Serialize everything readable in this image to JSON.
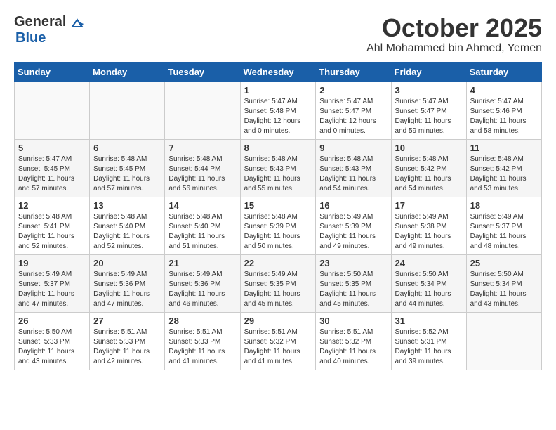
{
  "header": {
    "logo_general": "General",
    "logo_blue": "Blue",
    "month": "October 2025",
    "location": "Ahl Mohammed bin Ahmed, Yemen"
  },
  "calendar": {
    "days_of_week": [
      "Sunday",
      "Monday",
      "Tuesday",
      "Wednesday",
      "Thursday",
      "Friday",
      "Saturday"
    ],
    "rows": [
      [
        {
          "day": "",
          "info": ""
        },
        {
          "day": "",
          "info": ""
        },
        {
          "day": "",
          "info": ""
        },
        {
          "day": "1",
          "info": "Sunrise: 5:47 AM\nSunset: 5:48 PM\nDaylight: 12 hours\nand 0 minutes."
        },
        {
          "day": "2",
          "info": "Sunrise: 5:47 AM\nSunset: 5:47 PM\nDaylight: 12 hours\nand 0 minutes."
        },
        {
          "day": "3",
          "info": "Sunrise: 5:47 AM\nSunset: 5:47 PM\nDaylight: 11 hours\nand 59 minutes."
        },
        {
          "day": "4",
          "info": "Sunrise: 5:47 AM\nSunset: 5:46 PM\nDaylight: 11 hours\nand 58 minutes."
        }
      ],
      [
        {
          "day": "5",
          "info": "Sunrise: 5:47 AM\nSunset: 5:45 PM\nDaylight: 11 hours\nand 57 minutes."
        },
        {
          "day": "6",
          "info": "Sunrise: 5:48 AM\nSunset: 5:45 PM\nDaylight: 11 hours\nand 57 minutes."
        },
        {
          "day": "7",
          "info": "Sunrise: 5:48 AM\nSunset: 5:44 PM\nDaylight: 11 hours\nand 56 minutes."
        },
        {
          "day": "8",
          "info": "Sunrise: 5:48 AM\nSunset: 5:43 PM\nDaylight: 11 hours\nand 55 minutes."
        },
        {
          "day": "9",
          "info": "Sunrise: 5:48 AM\nSunset: 5:43 PM\nDaylight: 11 hours\nand 54 minutes."
        },
        {
          "day": "10",
          "info": "Sunrise: 5:48 AM\nSunset: 5:42 PM\nDaylight: 11 hours\nand 54 minutes."
        },
        {
          "day": "11",
          "info": "Sunrise: 5:48 AM\nSunset: 5:42 PM\nDaylight: 11 hours\nand 53 minutes."
        }
      ],
      [
        {
          "day": "12",
          "info": "Sunrise: 5:48 AM\nSunset: 5:41 PM\nDaylight: 11 hours\nand 52 minutes."
        },
        {
          "day": "13",
          "info": "Sunrise: 5:48 AM\nSunset: 5:40 PM\nDaylight: 11 hours\nand 52 minutes."
        },
        {
          "day": "14",
          "info": "Sunrise: 5:48 AM\nSunset: 5:40 PM\nDaylight: 11 hours\nand 51 minutes."
        },
        {
          "day": "15",
          "info": "Sunrise: 5:48 AM\nSunset: 5:39 PM\nDaylight: 11 hours\nand 50 minutes."
        },
        {
          "day": "16",
          "info": "Sunrise: 5:49 AM\nSunset: 5:39 PM\nDaylight: 11 hours\nand 49 minutes."
        },
        {
          "day": "17",
          "info": "Sunrise: 5:49 AM\nSunset: 5:38 PM\nDaylight: 11 hours\nand 49 minutes."
        },
        {
          "day": "18",
          "info": "Sunrise: 5:49 AM\nSunset: 5:37 PM\nDaylight: 11 hours\nand 48 minutes."
        }
      ],
      [
        {
          "day": "19",
          "info": "Sunrise: 5:49 AM\nSunset: 5:37 PM\nDaylight: 11 hours\nand 47 minutes."
        },
        {
          "day": "20",
          "info": "Sunrise: 5:49 AM\nSunset: 5:36 PM\nDaylight: 11 hours\nand 47 minutes."
        },
        {
          "day": "21",
          "info": "Sunrise: 5:49 AM\nSunset: 5:36 PM\nDaylight: 11 hours\nand 46 minutes."
        },
        {
          "day": "22",
          "info": "Sunrise: 5:49 AM\nSunset: 5:35 PM\nDaylight: 11 hours\nand 45 minutes."
        },
        {
          "day": "23",
          "info": "Sunrise: 5:50 AM\nSunset: 5:35 PM\nDaylight: 11 hours\nand 45 minutes."
        },
        {
          "day": "24",
          "info": "Sunrise: 5:50 AM\nSunset: 5:34 PM\nDaylight: 11 hours\nand 44 minutes."
        },
        {
          "day": "25",
          "info": "Sunrise: 5:50 AM\nSunset: 5:34 PM\nDaylight: 11 hours\nand 43 minutes."
        }
      ],
      [
        {
          "day": "26",
          "info": "Sunrise: 5:50 AM\nSunset: 5:33 PM\nDaylight: 11 hours\nand 43 minutes."
        },
        {
          "day": "27",
          "info": "Sunrise: 5:51 AM\nSunset: 5:33 PM\nDaylight: 11 hours\nand 42 minutes."
        },
        {
          "day": "28",
          "info": "Sunrise: 5:51 AM\nSunset: 5:33 PM\nDaylight: 11 hours\nand 41 minutes."
        },
        {
          "day": "29",
          "info": "Sunrise: 5:51 AM\nSunset: 5:32 PM\nDaylight: 11 hours\nand 41 minutes."
        },
        {
          "day": "30",
          "info": "Sunrise: 5:51 AM\nSunset: 5:32 PM\nDaylight: 11 hours\nand 40 minutes."
        },
        {
          "day": "31",
          "info": "Sunrise: 5:52 AM\nSunset: 5:31 PM\nDaylight: 11 hours\nand 39 minutes."
        },
        {
          "day": "",
          "info": ""
        }
      ]
    ]
  }
}
